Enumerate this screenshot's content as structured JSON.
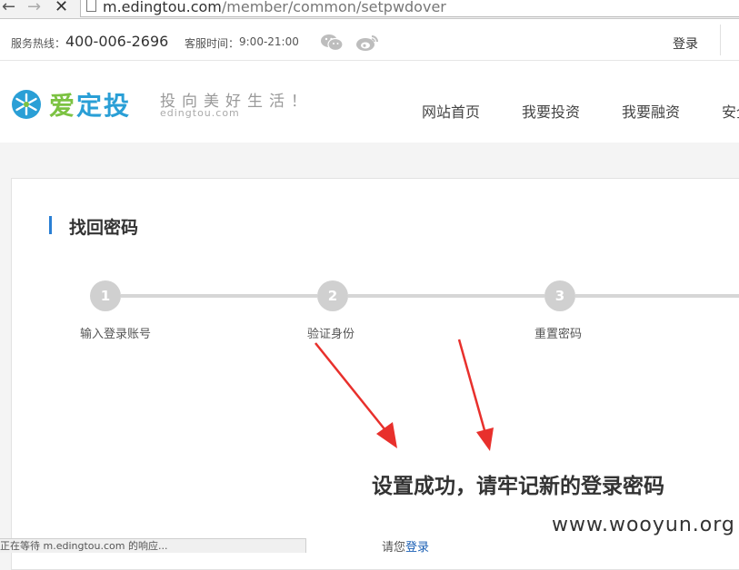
{
  "browser": {
    "url_host": "m.edingtou.com",
    "url_path": "/member/common/setpwdover"
  },
  "topbar": {
    "hotline_label": "服务热线：",
    "hotline_number": "400-006-2696",
    "hours_label": "客服时间：",
    "hours_value": "9:00-21:00",
    "login": "登录"
  },
  "header": {
    "logo_text_ai": "爱",
    "logo_text_rest": "定投",
    "slogan": "投向美好生活！",
    "logo_domain": "edingtou.com",
    "nav": [
      "网站首页",
      "我要投资",
      "我要融资",
      "安全"
    ]
  },
  "panel": {
    "title": "找回密码",
    "steps": [
      {
        "number": "1",
        "label": "输入登录账号"
      },
      {
        "number": "2",
        "label": "验证身份"
      },
      {
        "number": "3",
        "label": "重置密码"
      }
    ],
    "success_message": "设置成功，请牢记新的登录密码",
    "prompt_prefix": "请您",
    "prompt_link": "登录"
  },
  "statusbar": {
    "text": "正在等待 m.edingtou.com 的响应..."
  },
  "watermark": "www.wooyun.org",
  "colors": {
    "brand_blue": "#2a9fd6",
    "brand_green": "#7cc242",
    "step_gray": "#d0d0d0",
    "annotation_red": "#e8302c",
    "link_blue": "#1a5fb4"
  }
}
